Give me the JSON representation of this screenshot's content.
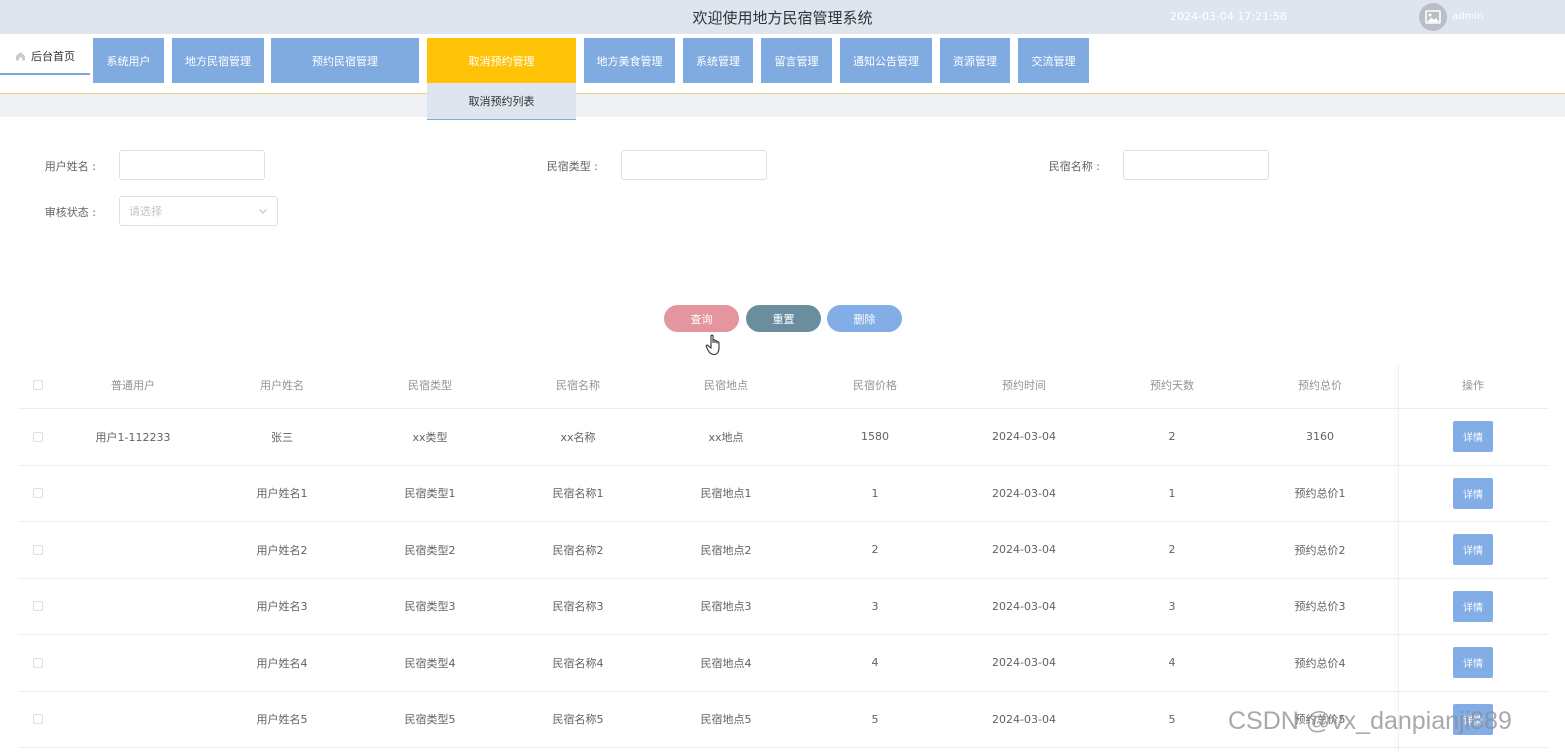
{
  "header": {
    "title": "欢迎使用地方民宿管理系统",
    "datetime": "2024-03-04 17:21:58",
    "username": "admin",
    "avatar_icon": "image-icon"
  },
  "nav": {
    "home_label": "后台首页",
    "home_icon": "home-icon",
    "items": [
      {
        "label": "系统用户"
      },
      {
        "label": "地方民宿管理"
      },
      {
        "label": "预约民宿管理"
      },
      {
        "label": "取消预约管理",
        "active": true
      },
      {
        "label": "地方美食管理"
      },
      {
        "label": "系统管理"
      },
      {
        "label": "留言管理"
      },
      {
        "label": "通知公告管理"
      },
      {
        "label": "资源管理"
      },
      {
        "label": "交流管理"
      }
    ],
    "dropdown_item": "取消预约列表"
  },
  "search": {
    "user_name_label": "用户姓名 :",
    "homestay_type_label": "民宿类型 :",
    "homestay_name_label": "民宿名称 :",
    "audit_status_label": "审核状态 :",
    "audit_status_placeholder": "请选择"
  },
  "buttons": {
    "query": "查询",
    "reset": "重置",
    "delete": "删除"
  },
  "table": {
    "headers": [
      "普通用户",
      "用户姓名",
      "民宿类型",
      "民宿名称",
      "民宿地点",
      "民宿价格",
      "预约时间",
      "预约天数",
      "预约总价",
      "操作"
    ],
    "detail_label": "详情",
    "rows": [
      [
        "用户1-112233",
        "张三",
        "xx类型",
        "xx名称",
        "xx地点",
        "1580",
        "2024-03-04",
        "2",
        "3160"
      ],
      [
        "",
        "用户姓名1",
        "民宿类型1",
        "民宿名称1",
        "民宿地点1",
        "1",
        "2024-03-04",
        "1",
        "预约总价1"
      ],
      [
        "",
        "用户姓名2",
        "民宿类型2",
        "民宿名称2",
        "民宿地点2",
        "2",
        "2024-03-04",
        "2",
        "预约总价2"
      ],
      [
        "",
        "用户姓名3",
        "民宿类型3",
        "民宿名称3",
        "民宿地点3",
        "3",
        "2024-03-04",
        "3",
        "预约总价3"
      ],
      [
        "",
        "用户姓名4",
        "民宿类型4",
        "民宿名称4",
        "民宿地点4",
        "4",
        "2024-03-04",
        "4",
        "预约总价4"
      ],
      [
        "",
        "用户姓名5",
        "民宿类型5",
        "民宿名称5",
        "民宿地点5",
        "5",
        "2024-03-04",
        "5",
        "预约总价5"
      ]
    ]
  },
  "watermark": "CSDN @vx_danpianji889",
  "colors": {
    "nav_blue": "#7fabe0",
    "nav_active": "#fec207",
    "query_pink": "#e5959d",
    "reset_slate": "#6b8e9e",
    "delete_blue": "#82ade6"
  }
}
